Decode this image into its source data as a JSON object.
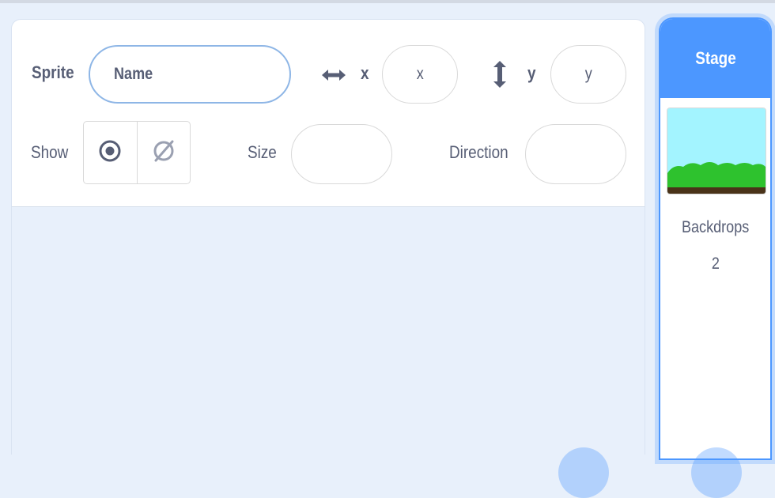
{
  "sprite_info": {
    "sprite_label": "Sprite",
    "name_placeholder": "Name",
    "x_label": "x",
    "x_placeholder": "x",
    "y_label": "y",
    "y_placeholder": "y",
    "show_label": "Show",
    "size_label": "Size",
    "direction_label": "Direction",
    "icons": {
      "x": "horizontal-arrows-icon",
      "y": "vertical-arrows-icon",
      "show": "eye-icon",
      "hide": "eye-crossed-icon"
    }
  },
  "stage": {
    "header": "Stage",
    "backdrops_label": "Backdrops",
    "backdrops_count": "2"
  },
  "colors": {
    "accent": "#4c97ff",
    "text": "#575e75",
    "background": "#e8f0fb",
    "thumbnail_sky": "#a3f4ff",
    "thumbnail_grass": "#2ec22e",
    "thumbnail_ground": "#4a3319"
  }
}
